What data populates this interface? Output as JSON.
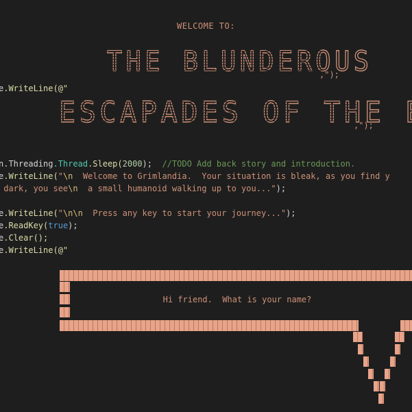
{
  "welcome_text": "WELCOME TO:",
  "title_line1": "THE BLUNDEROUS",
  "title_line1_comma": ",",
  "title_line1_tail": "\");",
  "title_line2": "ESCAPADES OF THE ELF",
  "title_line2_comma": ",",
  "title_line2_tail": "\");",
  "code": {
    "line1_obj": "e",
    "line1_method": ".WriteLine(@\"",
    "line2_obj": "n",
    "line2_ns1": ".Threading",
    "line2_cls": ".Thread",
    "line2_method": ".Sleep(",
    "line2_num": "2000",
    "line2_end": ");",
    "line2_comment": "  //TODO Add back story and introduction.",
    "line3_obj": "e",
    "line3_method": ".WriteLine(",
    "line3_str_open": "\"",
    "line3_esc1": "\\n",
    "line3_str": "  Welcome to Grimlandia.  Your situation is bleak, as you find y",
    "line4_str1": " dark, you see",
    "line4_esc": "\\n",
    "line4_str2": "  a small humanoid walking up to you...\"",
    "line4_end": ");",
    "line5_obj": "e",
    "line5_method": ".WriteLine(",
    "line5_str_open": "\"",
    "line5_esc": "\\n\\n",
    "line5_str": "  Press any key to start your journey...\"",
    "line5_end": ");",
    "line6_obj": "e",
    "line6_method": ".ReadKey(",
    "line6_kw": "true",
    "line6_end": ");",
    "line7_obj": "e",
    "line7_method": ".Clear();",
    "line8_obj": "e",
    "line8_method": ".WriteLine(@\""
  },
  "bubble_text": "Hi friend.  What is your name?",
  "colors": {
    "background": "#1e1e1e",
    "string": "#ce9178",
    "class": "#4ec9b0",
    "method": "#dcdcaa",
    "keyword": "#569cd6",
    "number": "#b5cea8",
    "comment": "#6a9955",
    "escape": "#d7ba7d",
    "bubble": "#e8a48a"
  }
}
